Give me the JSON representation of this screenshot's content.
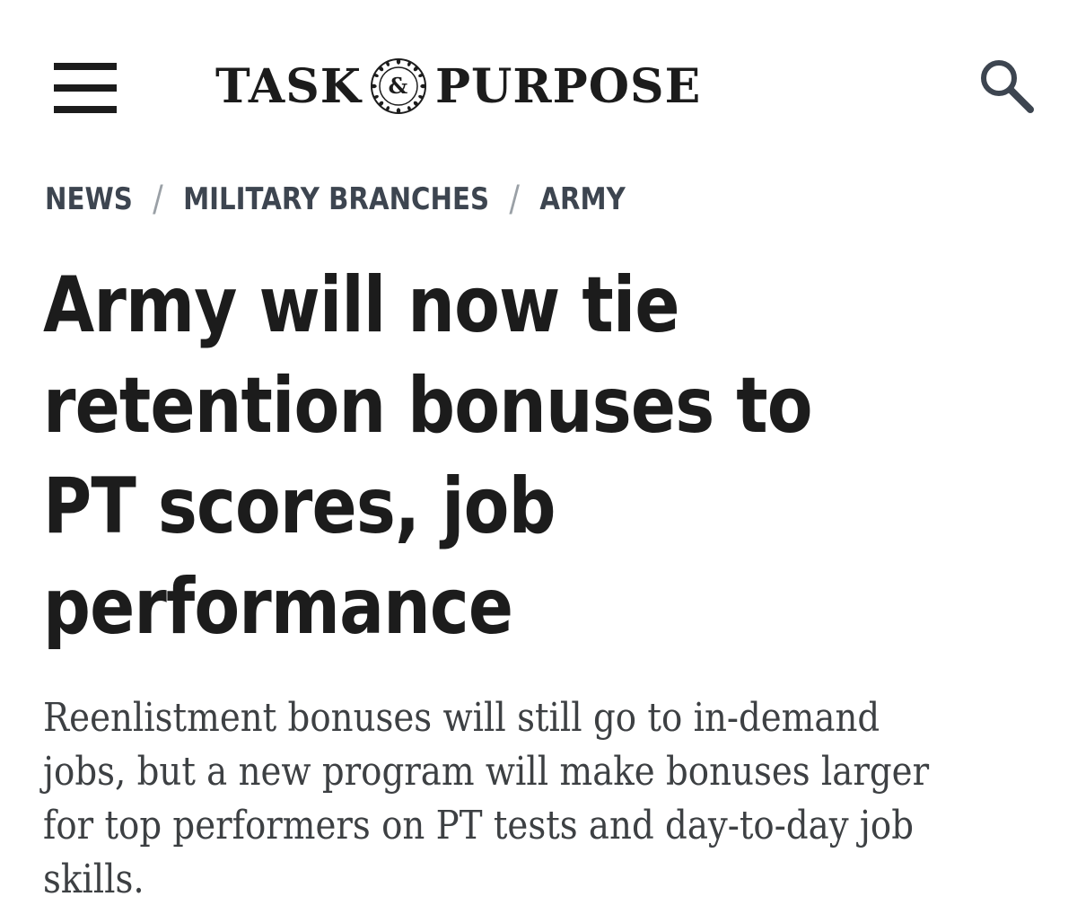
{
  "header": {
    "logo": {
      "left_text": "TASK",
      "emblem_text": "&",
      "right_text": "PURPOSE"
    },
    "menu_icon": "hamburger-menu-icon",
    "search_icon": "search-icon"
  },
  "breadcrumb": {
    "items": [
      {
        "label": "NEWS"
      },
      {
        "label": "MILITARY BRANCHES"
      },
      {
        "label": "ARMY"
      }
    ],
    "separator": "/"
  },
  "article": {
    "headline_lines": [
      "Army will now tie",
      "retention bonuses to",
      "PT scores, job",
      "performance"
    ],
    "dek_lines": [
      "Reenlistment bonuses will still go to in-demand",
      "jobs, but a new program will make bonuses larger",
      "for top performers on PT tests and day-to-day job",
      "skills."
    ]
  },
  "colors": {
    "text": "#1c1c1c",
    "breadcrumb": "#3d4550",
    "separator": "#9aa0a6",
    "dek": "#3d4043",
    "background": "#ffffff"
  }
}
